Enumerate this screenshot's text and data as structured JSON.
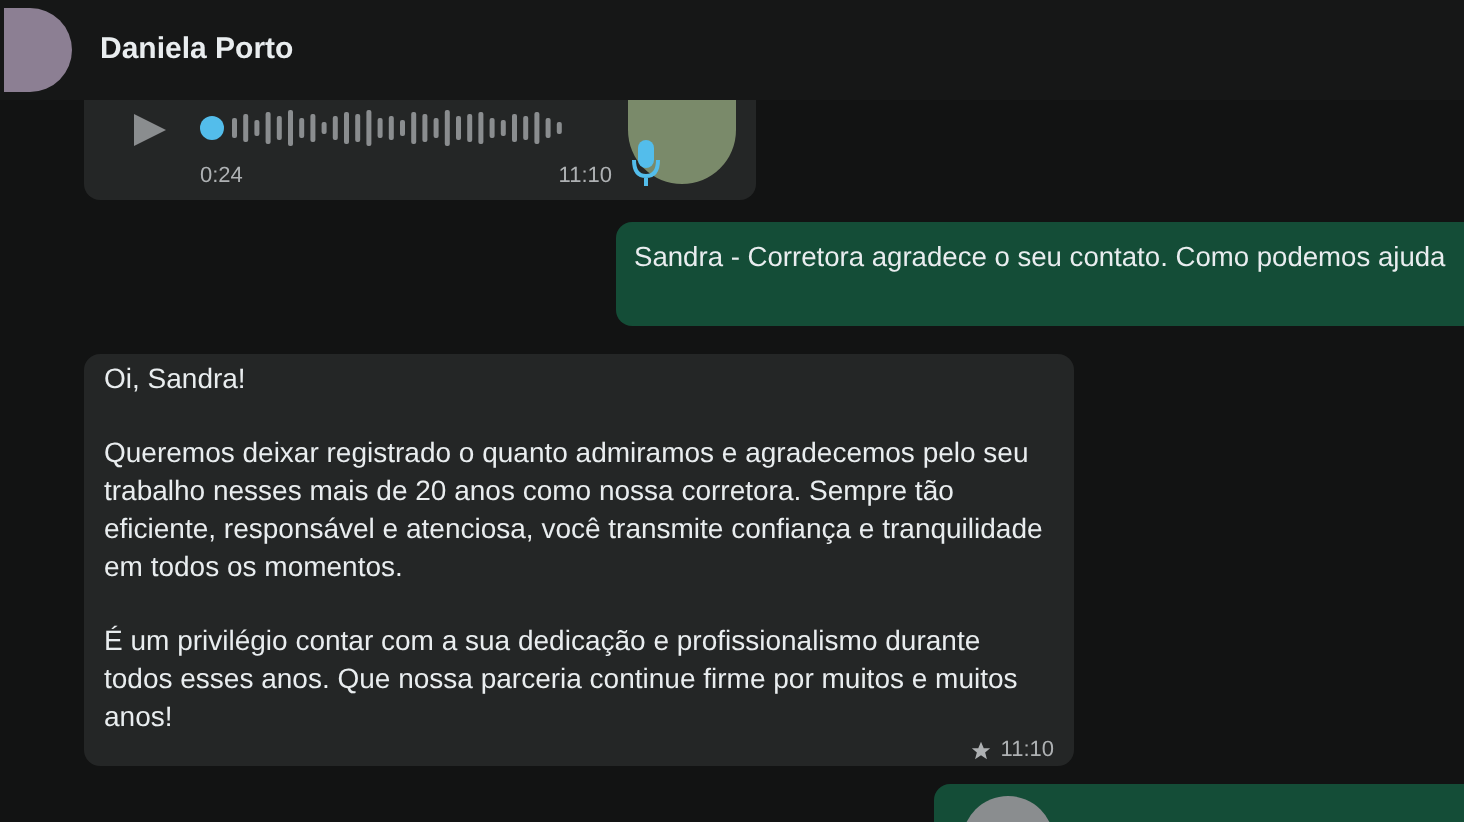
{
  "header": {
    "contact_name": "Daniela Porto"
  },
  "messages": [
    {
      "kind": "audio",
      "outgoing": false,
      "duration": "0:24",
      "time": "11:10"
    },
    {
      "kind": "text",
      "outgoing": true,
      "paragraphs": [
        "Sandra - Corretora agradece o seu contato. Como podemos ajuda"
      ]
    },
    {
      "kind": "text",
      "outgoing": false,
      "starred": true,
      "time": "11:10",
      "paragraphs": [
        "Oi, Sandra!",
        "Queremos deixar registrado o quanto admiramos e agradecemos pelo seu trabalho nesses mais de 20 anos como nossa corretora. Sempre tão eficiente, responsável e atenciosa, você transmite confiança e tranquilidade em todos os momentos.",
        "É um privilégio contar com a sua dedicação e profissionalismo durante todos esses anos. Que nossa parceria continue firme por muitos e muitos anos!"
      ]
    },
    {
      "kind": "contact",
      "outgoing": true
    }
  ]
}
